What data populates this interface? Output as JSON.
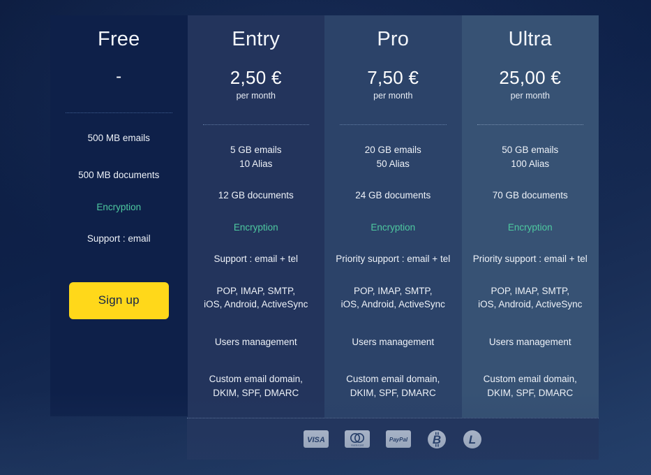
{
  "plans": [
    {
      "name": "Free",
      "price": "-",
      "period": "",
      "features": [
        "500 MB emails",
        "500 MB documents",
        "Encryption",
        "Support : email"
      ],
      "cta": "Sign up"
    },
    {
      "name": "Entry",
      "price": "2,50 €",
      "period": "per month",
      "features": [
        "5 GB emails\n10 Alias",
        "12 GB documents",
        "Encryption",
        "Support : email + tel",
        "POP, IMAP, SMTP,\niOS, Android, ActiveSync",
        "Users management",
        "Custom email domain,\nDKIM, SPF, DMARC"
      ]
    },
    {
      "name": "Pro",
      "price": "7,50 €",
      "period": "per month",
      "features": [
        "20 GB emails\n50 Alias",
        "24 GB documents",
        "Encryption",
        "Priority support : email + tel",
        "POP, IMAP, SMTP,\niOS, Android, ActiveSync",
        "Users management",
        "Custom email domain,\nDKIM, SPF, DMARC"
      ]
    },
    {
      "name": "Ultra",
      "price": "25,00 €",
      "period": "per month",
      "features": [
        "50 GB emails\n100 Alias",
        "70 GB documents",
        "Encryption",
        "Priority support : email + tel",
        "POP, IMAP, SMTP,\niOS, Android, ActiveSync",
        "Users management",
        "Custom email domain,\nDKIM, SPF, DMARC"
      ]
    }
  ],
  "payment_methods": [
    {
      "id": "visa-icon",
      "label": "VISA"
    },
    {
      "id": "mastercard-icon",
      "label": "mastercard"
    },
    {
      "id": "paypal-icon",
      "label": "PayPal"
    },
    {
      "id": "bitcoin-icon",
      "label": "Bitcoin"
    },
    {
      "id": "litecoin-icon",
      "label": "Litecoin"
    }
  ],
  "colors": {
    "accent_green": "#4ec9a0",
    "cta_yellow": "#ffd81a",
    "cta_text": "#132449",
    "col_free": "#0e2049",
    "col_entry": "#23345c",
    "col_pro": "#2c4369",
    "col_ultra": "#375274",
    "icon_fill": "#c7cfdd"
  }
}
